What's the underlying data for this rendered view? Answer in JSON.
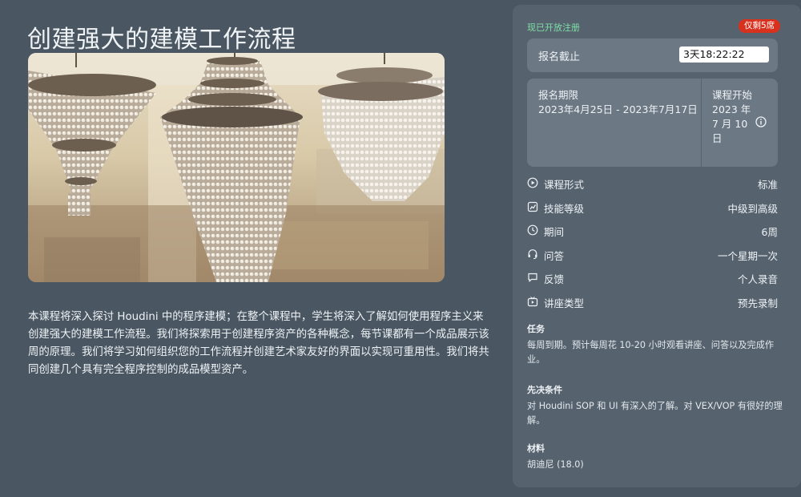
{
  "page": {
    "title": "创建强大的建模工作流程",
    "description": "本课程将深入探讨 Houdini 中的程序建模；在整个课程中，学生将深入了解如何使用程序主义来创建强大的建模工作流程。我们将探索用于创建程序资产的各种概念，每节课都有一个成品展示该周的原理。我们将学习如何组织您的工作流程并创建艺术家友好的界面以实现可重用性。我们将共同创建几个具有完全程序控制的成品模型资产。"
  },
  "panel": {
    "registration_status": "现已开放注册",
    "seats_badge": "仅剩5席",
    "deadline": {
      "label": "报名截止",
      "countdown": "3天18:22:22"
    },
    "period": {
      "label": "报名期限",
      "value": "2023年4月25日 - 2023年7月17日",
      "start_label": "课程开始",
      "start_value": "2023 年 7 月 10 日"
    },
    "specs": [
      {
        "icon": "play-circle-icon",
        "label": "课程形式",
        "value": "标准"
      },
      {
        "icon": "skill-chart-icon",
        "label": "技能等级",
        "value": "中级到高级"
      },
      {
        "icon": "clock-icon",
        "label": "期间",
        "value": "6周"
      },
      {
        "icon": "headset-icon",
        "label": "问答",
        "value": "一个星期一次"
      },
      {
        "icon": "speech-bubble-icon",
        "label": "反馈",
        "value": "个人录音"
      },
      {
        "icon": "video-lecture-icon",
        "label": "讲座类型",
        "value": "预先录制"
      }
    ],
    "assignments": {
      "heading": "任务",
      "body": "每周到期。预计每周花 10-20 小时观看讲座、问答以及完成作业。"
    },
    "prerequisites": {
      "heading": "先决条件",
      "body": "对 Houdini SOP 和 UI 有深入的了解。对 VEX/VOP 有很好的理解。"
    },
    "materials": {
      "heading": "材料",
      "body": "胡迪尼 (18.0)"
    }
  },
  "colors": {
    "background": "#4a5763",
    "panel": "#56636f",
    "card": "#6c7884",
    "accent_green": "#7fe0a5",
    "badge_red": "#d8321e"
  }
}
